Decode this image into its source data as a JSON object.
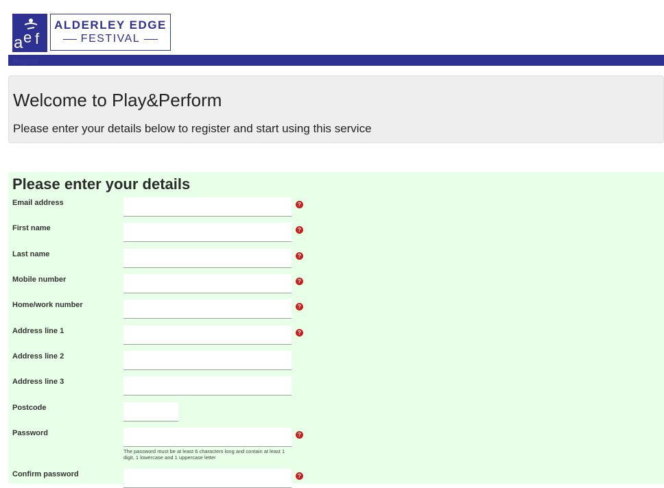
{
  "logo": {
    "mark": "aef",
    "line1": "ALDERLEY EDGE",
    "line2": "FESTIVAL"
  },
  "nav": {
    "register_label": "Register"
  },
  "welcome": {
    "title": "Welcome to Play&Perform",
    "subtitle": "Please enter your details below to register and start using this service"
  },
  "form": {
    "title": "Please enter your details",
    "fields": [
      {
        "label": "Email address",
        "value": "",
        "required": true
      },
      {
        "label": "First name",
        "value": "",
        "required": true
      },
      {
        "label": "Last name",
        "value": "",
        "required": true
      },
      {
        "label": "Mobile number",
        "value": "",
        "required": true
      },
      {
        "label": "Home/work number",
        "value": "",
        "required": true
      },
      {
        "label": "Address line 1",
        "value": "",
        "required": true
      },
      {
        "label": "Address line 2",
        "value": "",
        "required": false
      },
      {
        "label": "Address line 3",
        "value": "",
        "required": false
      },
      {
        "label": "Postcode",
        "value": "",
        "required": false
      },
      {
        "label": "Password",
        "value": "",
        "required": true
      },
      {
        "label": "Confirm password",
        "value": "",
        "required": true
      }
    ],
    "password_hint": "The password must be at least 6 characters long and contain at least 1 digit, 1 lowercase and 1 uppercase letter",
    "required_icon": "?"
  },
  "colors": {
    "brand": "#2e3192",
    "form_bg": "#e8ffe8",
    "required": "#c81e1e"
  }
}
